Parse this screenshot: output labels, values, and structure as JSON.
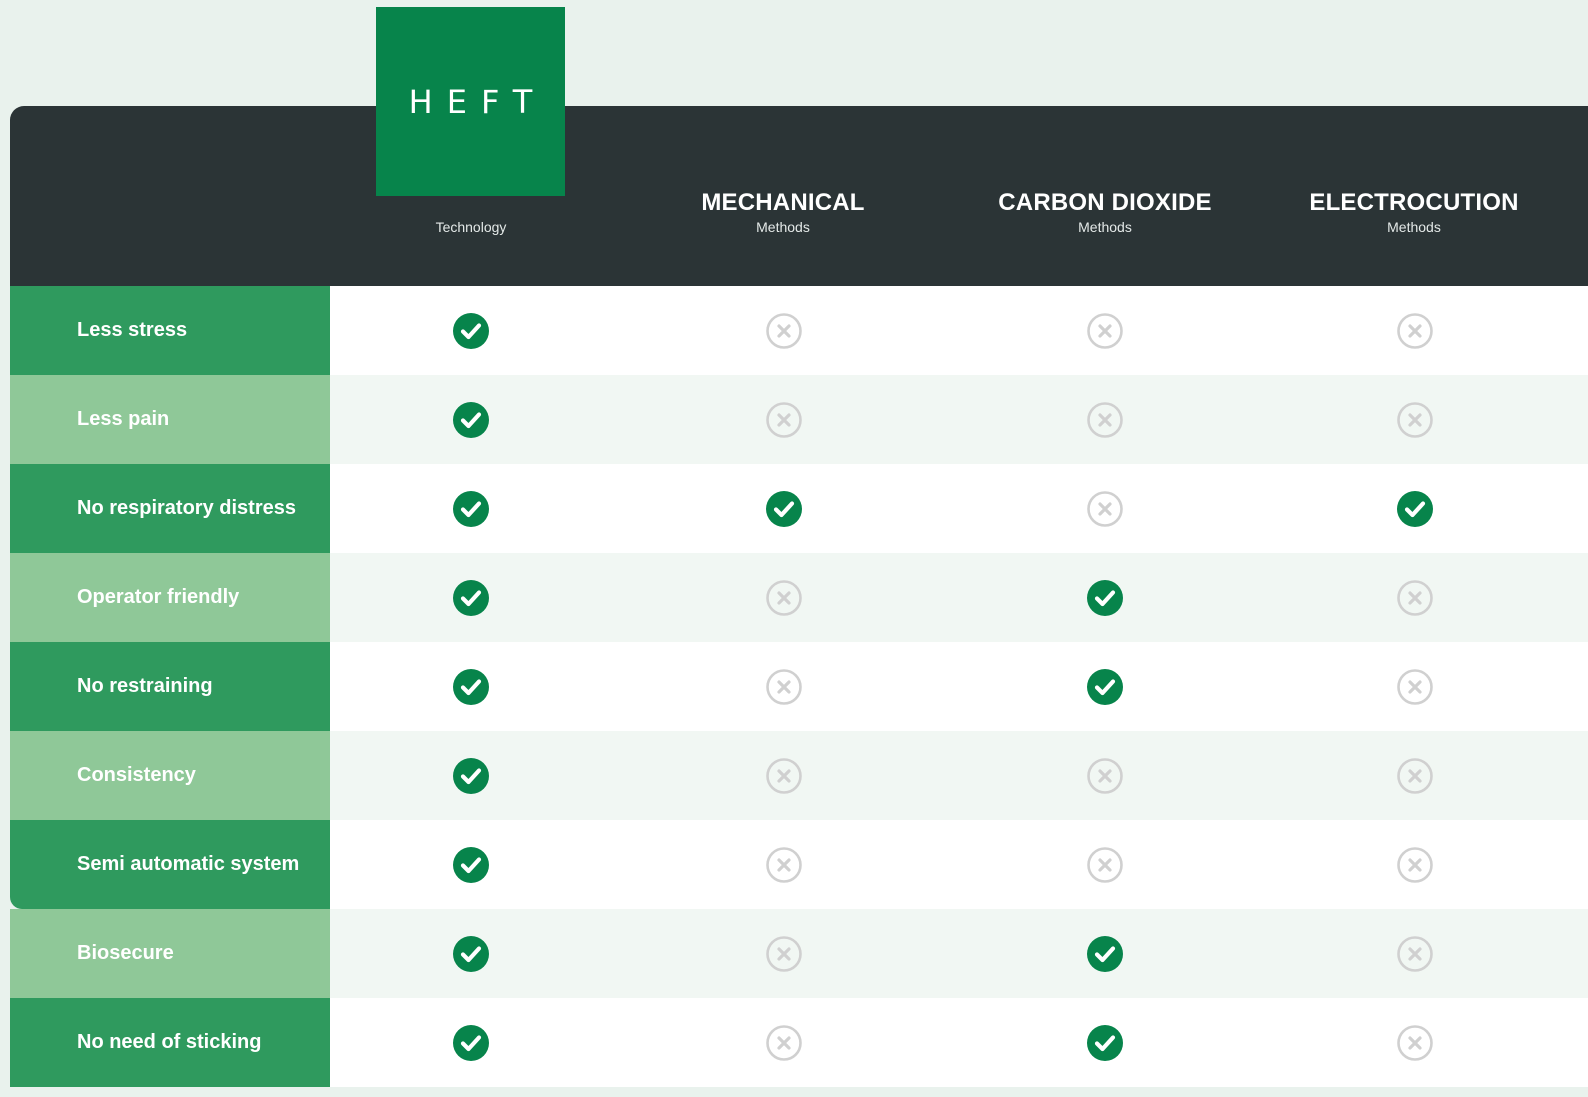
{
  "logo": {
    "text": "HEFT",
    "accent": "#07844b"
  },
  "columns": [
    {
      "title": "",
      "subtitle": "Technology"
    },
    {
      "title": "MECHANICAL",
      "subtitle": "Methods"
    },
    {
      "title": "CARBON DIOXIDE",
      "subtitle": "Methods"
    },
    {
      "title": "ELECTROCUTION",
      "subtitle": "Methods"
    }
  ],
  "rows": [
    {
      "label": "Less stress",
      "values": [
        true,
        false,
        false,
        false
      ]
    },
    {
      "label": "Less pain",
      "values": [
        true,
        false,
        false,
        false
      ]
    },
    {
      "label": "No respiratory distress",
      "values": [
        true,
        true,
        false,
        true
      ]
    },
    {
      "label": "Operator friendly",
      "values": [
        true,
        false,
        true,
        false
      ]
    },
    {
      "label": "No restraining",
      "values": [
        true,
        false,
        true,
        false
      ]
    },
    {
      "label": "Consistency",
      "values": [
        true,
        false,
        false,
        false
      ]
    },
    {
      "label": "Semi automatic system",
      "values": [
        true,
        false,
        false,
        false
      ]
    },
    {
      "label": "Biosecure",
      "values": [
        true,
        false,
        true,
        false
      ]
    },
    {
      "label": "No need of sticking",
      "values": [
        true,
        false,
        true,
        false
      ]
    }
  ],
  "colors": {
    "header_bg": "#2b3436",
    "check": "#07844b",
    "cross": "#d0d0d0",
    "label_dark": "#2f9a5e",
    "label_light": "#8fc898"
  },
  "icons": {
    "yes": "check-circle-icon",
    "no": "x-circle-icon"
  }
}
